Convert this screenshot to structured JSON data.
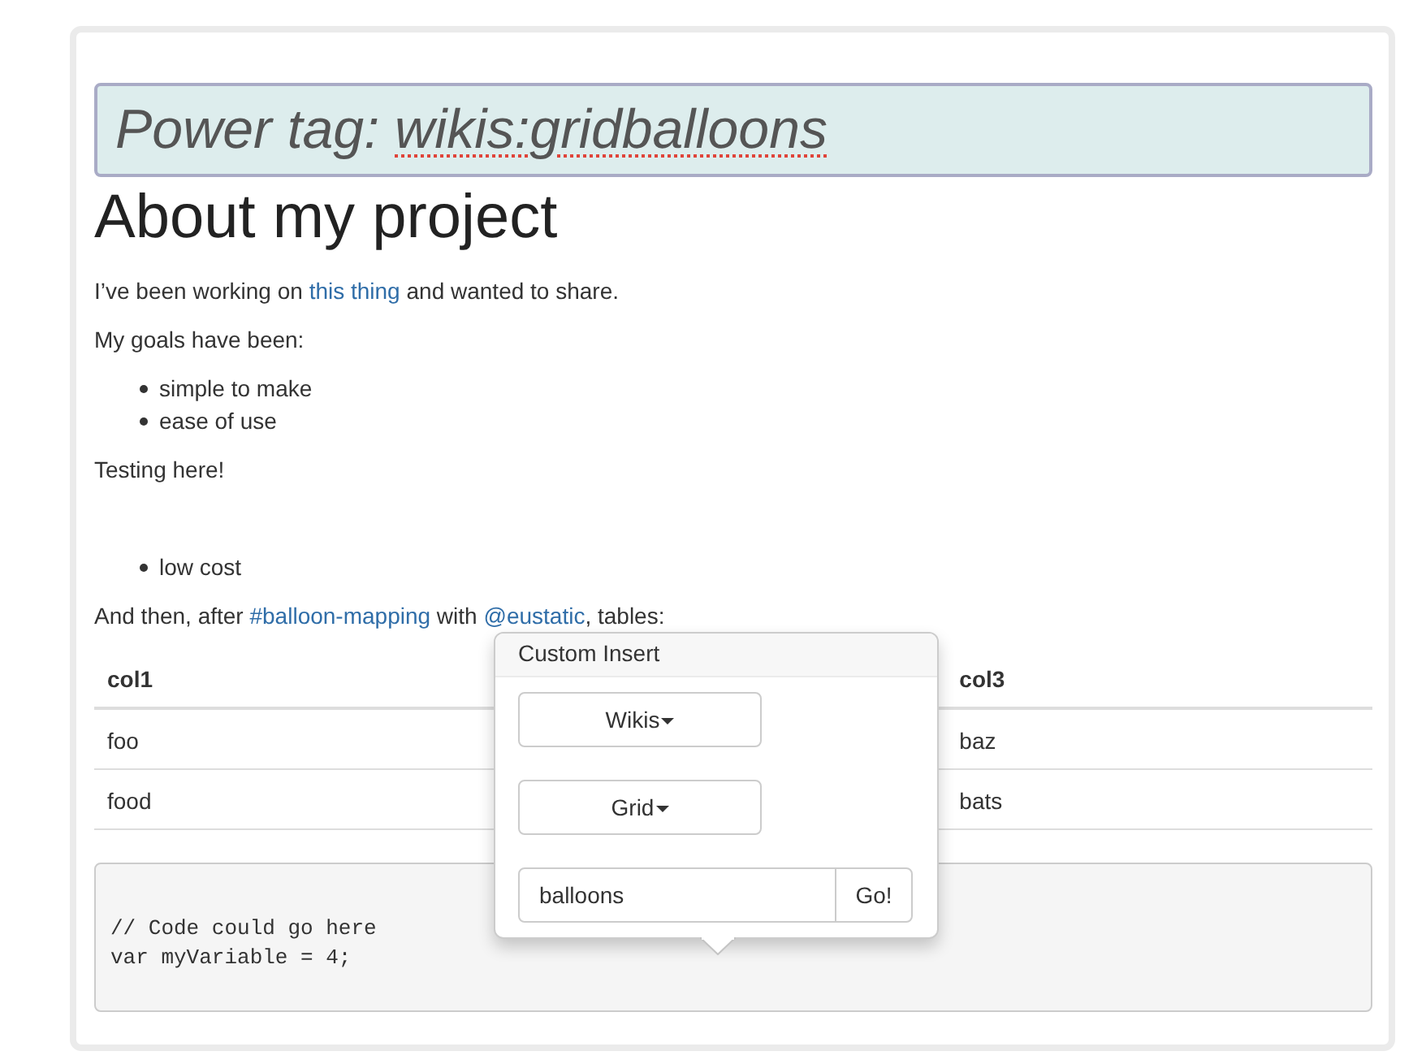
{
  "title_field": {
    "label": "Power tag:",
    "value": "wikis:gridballoons",
    "spellcheck_error": true
  },
  "heading": "About my project",
  "blocks": [
    {
      "kind": "paragraph",
      "parts": [
        {
          "kind": "text",
          "text": "I’ve been working on "
        },
        {
          "kind": "link",
          "text": "this thing"
        },
        {
          "kind": "text",
          "text": " and wanted to share."
        }
      ]
    },
    {
      "kind": "paragraph",
      "parts": [
        {
          "kind": "text",
          "text": "My goals have been:"
        }
      ]
    },
    {
      "kind": "list",
      "items": [
        "simple to make",
        "ease of use"
      ]
    },
    {
      "kind": "paragraph",
      "parts": [
        {
          "kind": "text",
          "text": "Testing here!"
        }
      ]
    },
    {
      "kind": "blank"
    },
    {
      "kind": "list",
      "items": [
        "low cost"
      ]
    },
    {
      "kind": "paragraph",
      "parts": [
        {
          "kind": "text",
          "text": "And then, after "
        },
        {
          "kind": "link",
          "text": "#balloon-mapping"
        },
        {
          "kind": "text",
          "text": " with "
        },
        {
          "kind": "link",
          "text": "@eustatic"
        },
        {
          "kind": "text",
          "text": ", tables:"
        }
      ]
    }
  ],
  "table": {
    "columns": [
      "col1",
      "col3"
    ],
    "rows": [
      [
        "foo",
        "baz"
      ],
      [
        "food",
        "bats"
      ]
    ]
  },
  "code_block": {
    "lines": [
      "// Code could go here",
      "var myVariable = 4;"
    ]
  },
  "popover": {
    "title": "Custom Insert",
    "dropdowns": [
      "Wikis",
      "Grid"
    ],
    "input": {
      "value": "balloons"
    },
    "submit": "Go!"
  }
}
